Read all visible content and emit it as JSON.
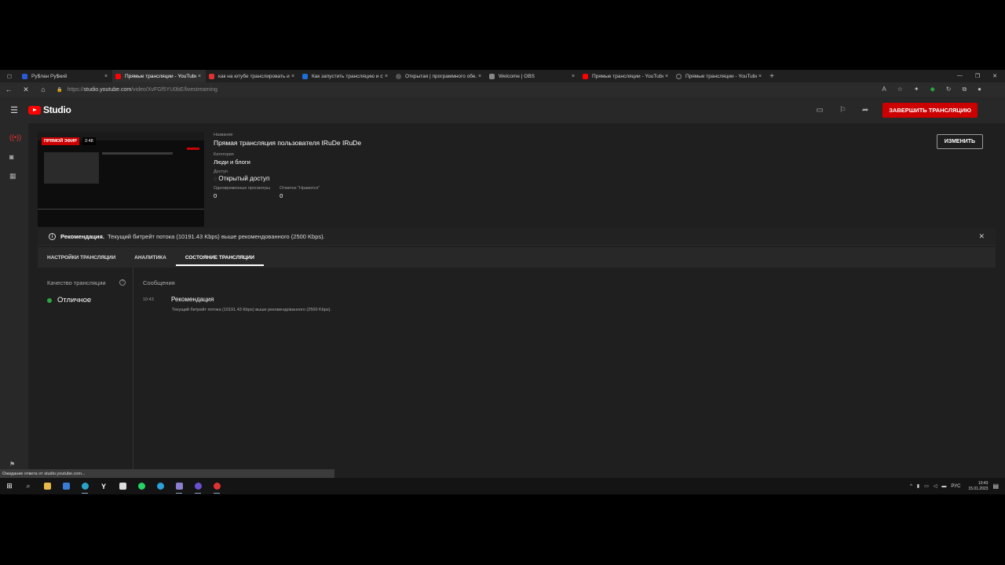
{
  "browser": {
    "tabs": [
      {
        "title": "Ру$лан Ру$кий",
        "favicon_color": "#2a5bd7",
        "active": false
      },
      {
        "title": "Прямые трансляции - YouTube",
        "favicon_color": "#ff0000",
        "active": true
      },
      {
        "title": "как на ютубе транслировать и...",
        "favicon_color": "#e03030",
        "active": false
      },
      {
        "title": "Как запустить трансляцию и ст...",
        "favicon_color": "#1d6fd6",
        "active": false
      },
      {
        "title": "Открытая | программного обе...",
        "favicon_color": "#555555",
        "active": false
      },
      {
        "title": "Welcome | OBS",
        "favicon_color": "#888888",
        "active": false
      },
      {
        "title": "Прямые трансляции - YouTube",
        "favicon_color": "#ff0000",
        "active": false
      },
      {
        "title": "Прямые трансляции - YouTube",
        "favicon_color": "#666666",
        "active": false
      }
    ],
    "url_prefix": "https://",
    "url_host": "studio.youtube.com",
    "url_path": "/video/XvFGf5YU0bE/livestreaming",
    "status_text": "Ожидание ответа от studio.youtube.com..."
  },
  "header": {
    "logo_text": "Studio",
    "end_stream_label": "ЗАВЕРШИТЬ ТРАНСЛЯЦИЮ"
  },
  "preview": {
    "live_badge": "ПРЯМОЙ ЭФИР",
    "live_time": "2:48"
  },
  "details": {
    "title_label": "Название",
    "title_value": "Прямая трансляция пользователя IRuDe IRuDe",
    "category_label": "Категория",
    "category_value": "Люди и блоги",
    "access_label": "Доступ",
    "access_value": "Открытый доступ",
    "viewers_label": "Одновременные просмотры",
    "viewers_value": "0",
    "likes_label": "Отметки \"Нравится\"",
    "likes_value": "0",
    "edit_label": "ИЗМЕНИТЬ"
  },
  "notice": {
    "title": "Рекомендация.",
    "text": "Текущий битрейт потока (10191.43 Kbps) выше рекомендованного (2500 Kbps)."
  },
  "stream_tabs": [
    {
      "label": "НАСТРОЙКИ ТРАНСЛЯЦИИ",
      "active": false
    },
    {
      "label": "АНАЛИТИКА",
      "active": false
    },
    {
      "label": "СОСТОЯНИЕ ТРАНСЛЯЦИИ",
      "active": true
    }
  ],
  "health": {
    "title": "Качество трансляции",
    "status": "Отличное",
    "status_color": "#2ba640"
  },
  "messages": {
    "title": "Сообщения",
    "time": "10:43",
    "heading": "Рекомендация",
    "body": "Текущий битрейт потока (10191.43 Kbps) выше рекомендованного (2500 Kbps)."
  },
  "taskbar": {
    "lang": "РУС",
    "time": "10:43",
    "date": "15.01.2023"
  },
  "colors": {
    "accent_red": "#cc0000",
    "background": "#1f1f1f"
  }
}
